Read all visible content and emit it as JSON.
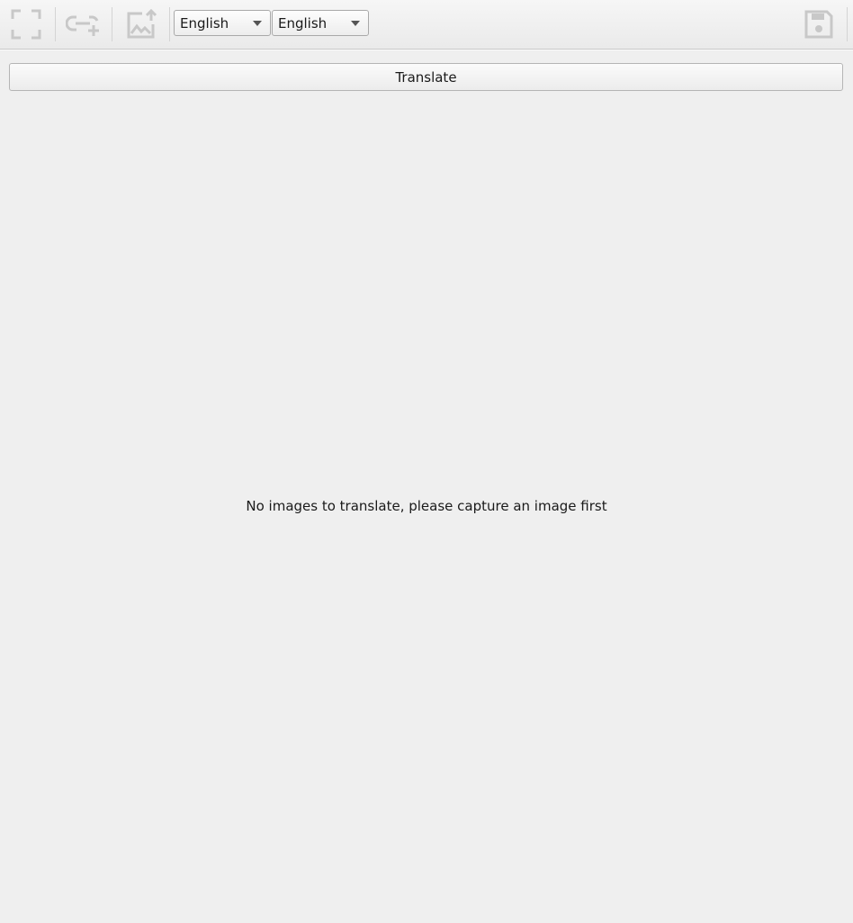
{
  "toolbar": {
    "buttons": [
      {
        "icon": "fullscreen-capture-icon"
      },
      {
        "icon": "add-link-icon"
      },
      {
        "icon": "upload-image-icon"
      },
      {
        "icon": "save-icon"
      }
    ],
    "source_language": "English",
    "target_language": "English"
  },
  "main": {
    "translate_label": "Translate",
    "empty_message": "No images to translate, please capture an image first"
  },
  "colors": {
    "background": "#efefef",
    "disabled_icon": "#c8c8c8"
  }
}
